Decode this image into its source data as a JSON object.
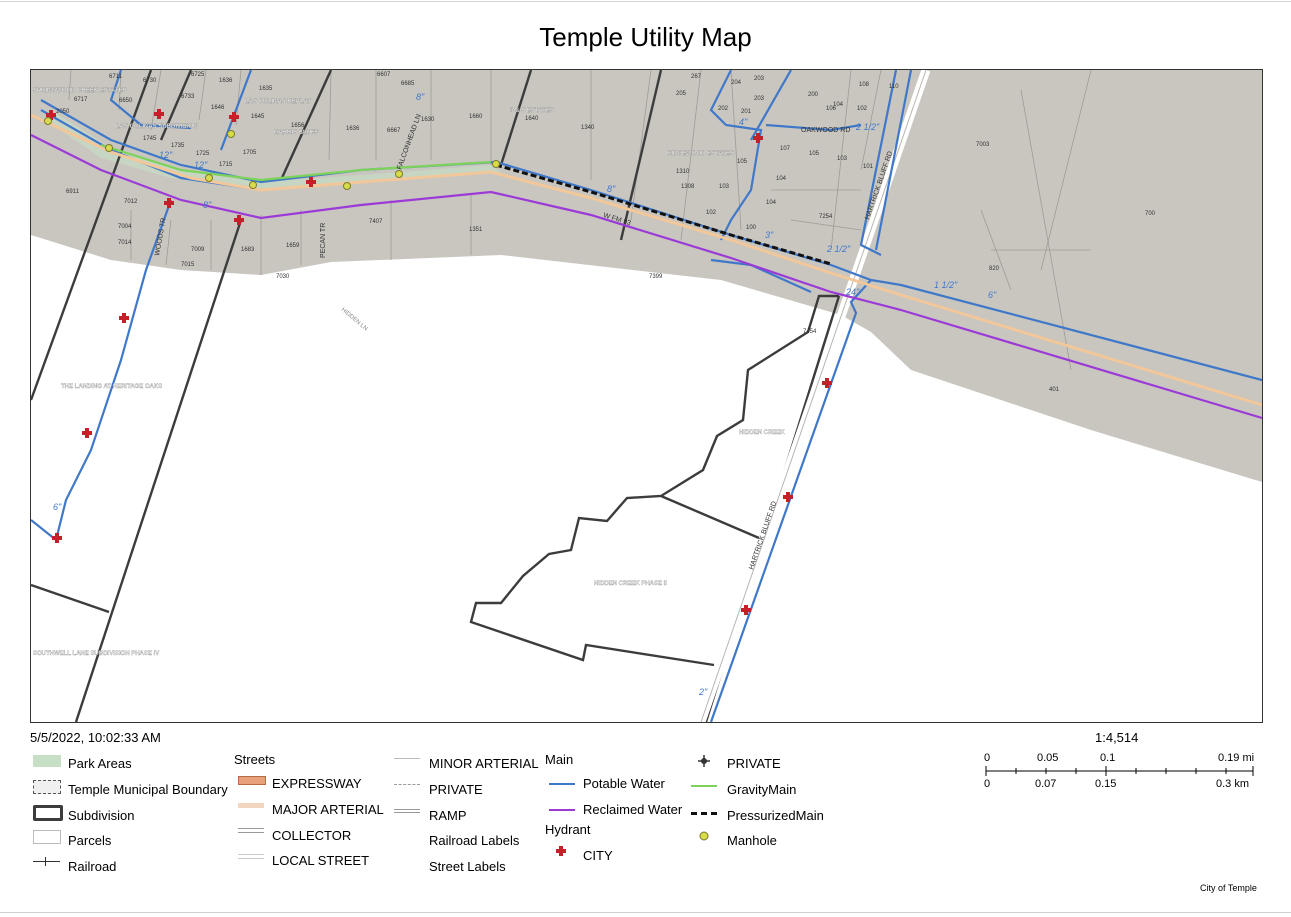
{
  "title": "Temple Utility Map",
  "timestamp": "5/5/2022, 10:02:33 AM",
  "scale_ratio": "1:4,514",
  "credit": "City of Temple",
  "scalebar": {
    "mi_labels": [
      "0",
      "0.05",
      "0.1",
      "0.19 mi"
    ],
    "km_labels": [
      "0",
      "0.07",
      "0.15",
      "0.3 km"
    ]
  },
  "legend": {
    "col1": [
      "Park Areas",
      "Temple Municipal Boundary",
      "Subdivision",
      "Parcels",
      "Railroad"
    ],
    "streets_heading": "Streets",
    "streets": [
      "EXPRESSWAY",
      "MAJOR ARTERIAL",
      "COLLECTOR",
      "LOCAL STREET"
    ],
    "col3": [
      "MINOR ARTERIAL",
      "PRIVATE",
      "RAMP",
      "Railroad Labels",
      "Street Labels"
    ],
    "main_heading": "Main",
    "main": [
      "Potable Water",
      "Reclaimed Water"
    ],
    "hydrant_heading": "Hydrant",
    "hydrant": [
      "CITY"
    ],
    "col5": [
      "PRIVATE",
      "GravityMain",
      "PressurizedMain",
      "Manhole"
    ]
  },
  "colors": {
    "parcel_fill": "#c9c6c0",
    "potable_water": "#3f78c8",
    "reclaimed_water": "#9b3ad6",
    "gravity_main": "#7dd35a",
    "major_arterial": "#f2c79a",
    "hydrant": "#c4202a",
    "manhole": "#d8dc4a",
    "subdivision": "#3c3c3c",
    "park": "#c7dfc5"
  },
  "map_labels": {
    "subdivisions": [
      "SPRINGWOOD CREEK ESTATES",
      "LAS COLINAS SUBDIVISION",
      "LAS COLINAS REPLAT",
      "HARRIS BLUFF",
      "G & S ESTATES",
      "RIDGEWOOD ESTATES",
      "THE LANDING AT HERITAGE OAKS",
      "HIDDEN CREEK",
      "HIDDEN CREEK PHASE II",
      "SOUTHWELL LANE SUBDIVISION PHASE IV"
    ],
    "streets": [
      "W FM 93",
      "OAKWOOD RD",
      "HARTRICK BLUFF RD",
      "PECAN TR",
      "FALCONHEAD LN",
      "HIDDEN LN",
      "WOODS TR"
    ],
    "pipe_sizes": [
      "12\"",
      "12\"",
      "8\"",
      "8\"",
      "4\"",
      "8\"",
      "2 1/2\"",
      "3\"",
      "2 1/2\"",
      "24\"",
      "1 1/2\"",
      "6\"",
      "6\"",
      "2\""
    ],
    "parcels": [
      "6711",
      "6730",
      "6725",
      "1636",
      "1635",
      "6607",
      "6685",
      "6717",
      "6650",
      "6733",
      "1646",
      "1645",
      "1656",
      "1636",
      "6667",
      "1630",
      "1660",
      "1640",
      "1340",
      "2050",
      "1745",
      "1735",
      "1725",
      "1715",
      "1705",
      "6911",
      "7012",
      "7004",
      "7014",
      "7009",
      "7015",
      "1683",
      "1659",
      "7030",
      "7407",
      "1351",
      "7399",
      "267",
      "204",
      "205",
      "203",
      "202",
      "201",
      "200",
      "107",
      "106",
      "108",
      "110",
      "104",
      "102",
      "105",
      "103",
      "101",
      "203",
      "1310",
      "1308",
      "103",
      "102",
      "105",
      "104",
      "100",
      "197",
      "7254",
      "7003",
      "700",
      "820",
      "7454",
      "401"
    ]
  }
}
